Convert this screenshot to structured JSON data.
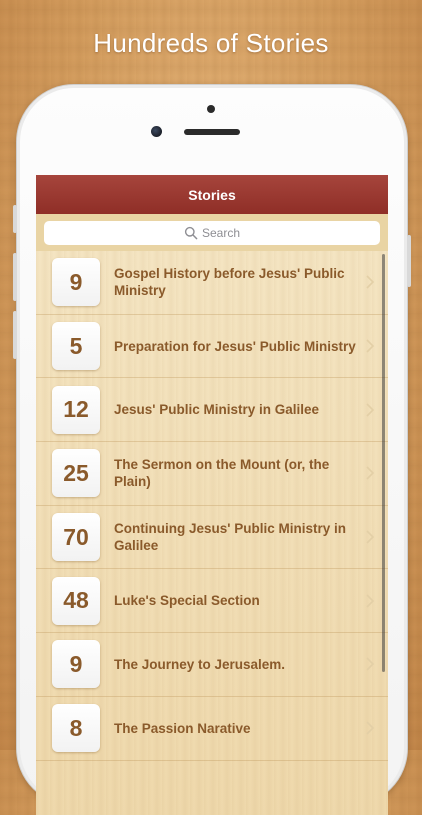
{
  "headline": "Hundreds of Stories",
  "navbar": {
    "title": "Stories"
  },
  "search": {
    "placeholder": "Search"
  },
  "stories": [
    {
      "count": "9",
      "title": "Gospel History before Jesus' Public Ministry"
    },
    {
      "count": "5",
      "title": "Preparation for Jesus' Public Ministry"
    },
    {
      "count": "12",
      "title": "Jesus' Public Ministry in Galilee"
    },
    {
      "count": "25",
      "title": "The Sermon on the Mount (or, the Plain)"
    },
    {
      "count": "70",
      "title": "Continuing Jesus' Public Ministry in Galilee"
    },
    {
      "count": "48",
      "title": "Luke's Special Section"
    },
    {
      "count": "9",
      "title": "The Journey to Jerusalem."
    },
    {
      "count": "8",
      "title": "The Passion Narative"
    }
  ],
  "colors": {
    "navbar": "#9a3a32",
    "text_brown": "#8a5a2b",
    "parchment": "#f3e2bd",
    "background_wood": "#d9a466"
  },
  "icons": {
    "search": "magnifier-icon",
    "row_accessory": "chevron-right-icon"
  }
}
